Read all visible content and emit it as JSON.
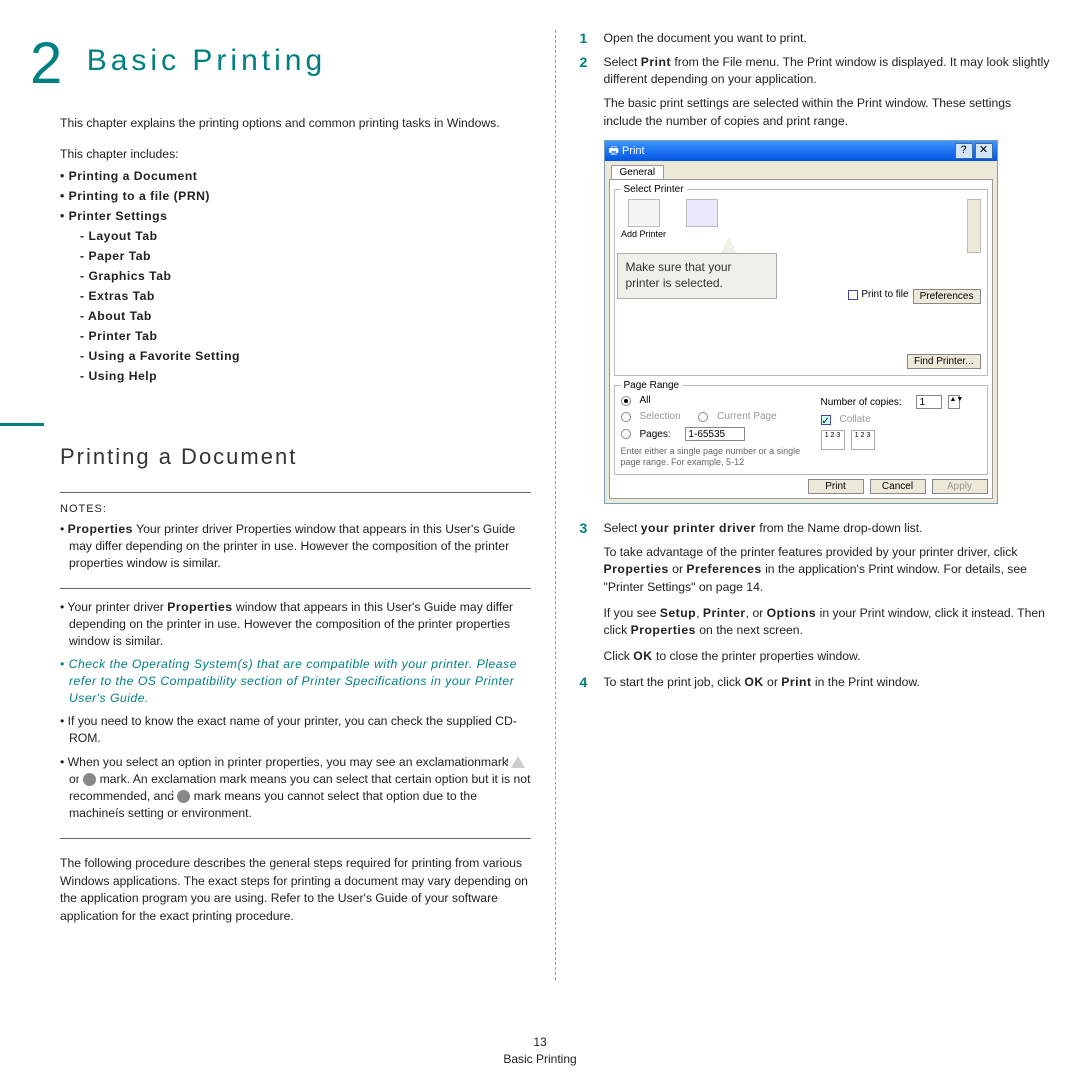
{
  "chapter_number": "2",
  "chapter_title": "Basic Printing",
  "intro": "This chapter explains the printing options and common printing tasks in Windows.",
  "toc_label": "This chapter includes:",
  "toc": {
    "i1": "Printing a Document",
    "i2": "Printing to a file (PRN)",
    "i3": "Printer Settings",
    "s1": "Layout Tab",
    "s2": "Paper Tab",
    "s3": "Graphics Tab",
    "s4": "Extras Tab",
    "s5": "About Tab",
    "s6": "Printer Tab",
    "s7": "Using a Favorite Setting",
    "s8": "Using Help"
  },
  "section_title": "Printing a Document",
  "notes_label": "NOTES:",
  "note1": "Your printer driver Properties window that appears in this User's Guide may differ depending on the printer in use. However the composition of the printer properties window is similar.",
  "note2": "Check the Operating System(s) that are compatible with your printer. Please refer to the OS Compatibility section of Printer Specifications in your Printer User's Guide.",
  "note3": "If you need to know the exact name of your printer, you can check the supplied CD-ROM.",
  "note4a": "When you select an option in printer properties, you may see an exclamationmark ",
  "note4b": " or ",
  "note4c": " mark. An exclamation mark means you can select that certain option but it is not recommended, and ",
  "note4d": " mark means you cannot select that option due to the machineís setting or environment.",
  "following": "The following procedure describes the general steps required for printing from various Windows applications. The exact steps for printing a document may vary depending on the application program you are using. Refer to the User's Guide of your software application for the exact printing procedure.",
  "step1": "Open the document you want to print.",
  "step2a": "Select ",
  "step2b": "Print",
  "step2c": " from the File menu. The Print window is displayed. It may look slightly different depending on your application.",
  "step2sub": "The basic print settings are selected within the Print window. These settings include the number of copies and print range.",
  "callout": "Make sure that your printer is selected.",
  "dlg": {
    "title": "Print",
    "help": "?",
    "close": "✕",
    "tab": "General",
    "fieldset1": "Select Printer",
    "add_printer": "Add Printer",
    "print_to_file": "Print to file",
    "preferences": "Preferences",
    "find_printer": "Find Printer...",
    "fieldset2": "Page Range",
    "all": "All",
    "selection": "Selection",
    "current_page": "Current Page",
    "pages": "Pages:",
    "pages_val": "1-65535",
    "pages_hint": "Enter either a single page number or a single page range. For example, 5-12",
    "copies": "Number of copies:",
    "copies_val": "1",
    "collate": "Collate",
    "print": "Print",
    "cancel": "Cancel",
    "apply": "Apply"
  },
  "step3a": "Select ",
  "step3b": "your printer driver",
  "step3c": " from the Name drop-down list.",
  "step3sub1a": "To take advantage of the printer features provided by your printer driver, click ",
  "step3sub1b": "Properties",
  "step3sub1c": " or ",
  "step3sub1d": "Preferences",
  "step3sub1e": " in the application's Print window. For details, see \"Printer Settings\" on page 14.",
  "step3sub2a": "If you see ",
  "step3sub2b": "Setup",
  "step3sub2c": ", ",
  "step3sub2d": "Printer",
  "step3sub2e": ", or ",
  "step3sub2f": "Options",
  "step3sub2g": " in your Print window, click it instead. Then click ",
  "step3sub2h": "Properties",
  "step3sub2i": " on the next screen.",
  "step3sub3": "Click OK to close the printer properties window.",
  "step4a": "To start the print job, click ",
  "step4b": "OK",
  "step4c": " or ",
  "step4d": "Print",
  "step4e": " in the Print window.",
  "footer_page": "13",
  "footer_title": "Basic Printing"
}
